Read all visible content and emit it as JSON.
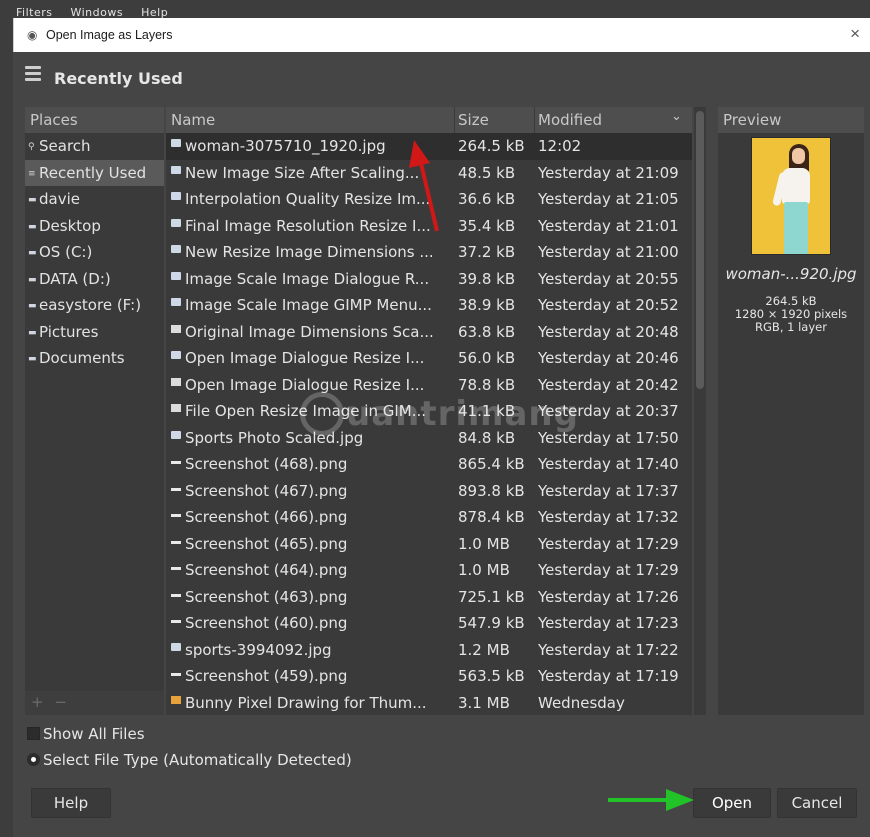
{
  "background_menu": [
    "Filters",
    "Windows",
    "Help"
  ],
  "dialog": {
    "title": "Open Image as Layers",
    "close_label": "×",
    "header_title": "Recently Used"
  },
  "places": {
    "header": "Places",
    "items": [
      {
        "label": "Search",
        "icon": "search-icon"
      },
      {
        "label": "Recently Used",
        "icon": "recent-icon",
        "selected": true
      },
      {
        "label": "davie",
        "icon": "folder-icon"
      },
      {
        "label": "Desktop",
        "icon": "folder-icon"
      },
      {
        "label": "OS (C:)",
        "icon": "drive-icon"
      },
      {
        "label": "DATA (D:)",
        "icon": "drive-icon"
      },
      {
        "label": "easystore (F:)",
        "icon": "drive-icon"
      },
      {
        "label": "Pictures",
        "icon": "folder-icon"
      },
      {
        "label": "Documents",
        "icon": "folder-icon"
      }
    ],
    "footer_add": "+",
    "footer_remove": "−"
  },
  "file_list": {
    "columns": {
      "name": "Name",
      "size": "Size",
      "modified": "Modified"
    },
    "rows": [
      {
        "name": "woman-3075710_1920.jpg",
        "size": "264.5 kB",
        "modified": "12:02",
        "type": "img",
        "selected": true
      },
      {
        "name": "New Image Size After Scaling...",
        "size": "48.5 kB",
        "modified": "Yesterday at 21:09",
        "type": "img"
      },
      {
        "name": "Interpolation Quality Resize Im...",
        "size": "36.6 kB",
        "modified": "Yesterday at 21:05",
        "type": "img"
      },
      {
        "name": "Final Image Resolution Resize I...",
        "size": "35.4 kB",
        "modified": "Yesterday at 21:01",
        "type": "img"
      },
      {
        "name": "New Resize Image Dimensions ...",
        "size": "37.2 kB",
        "modified": "Yesterday at 21:00",
        "type": "img"
      },
      {
        "name": "Image Scale Image Dialogue R...",
        "size": "39.8 kB",
        "modified": "Yesterday at 20:55",
        "type": "img"
      },
      {
        "name": "Image Scale Image GIMP Menu...",
        "size": "38.9 kB",
        "modified": "Yesterday at 20:52",
        "type": "img"
      },
      {
        "name": "Original Image Dimensions Sca...",
        "size": "63.8 kB",
        "modified": "Yesterday at 20:48",
        "type": "jpg2"
      },
      {
        "name": "Open Image Dialogue Resize I...",
        "size": "56.0 kB",
        "modified": "Yesterday at 20:46",
        "type": "img"
      },
      {
        "name": "Open Image Dialogue Resize I...",
        "size": "78.8 kB",
        "modified": "Yesterday at 20:42",
        "type": "jpg2"
      },
      {
        "name": "File Open Resize Image in GIM...",
        "size": "41.1 kB",
        "modified": "Yesterday at 20:37",
        "type": "jpg2"
      },
      {
        "name": "Sports Photo Scaled.jpg",
        "size": "84.8 kB",
        "modified": "Yesterday at 17:50",
        "type": "img"
      },
      {
        "name": "Screenshot (468).png",
        "size": "865.4 kB",
        "modified": "Yesterday at 17:40",
        "type": "png"
      },
      {
        "name": "Screenshot (467).png",
        "size": "893.8 kB",
        "modified": "Yesterday at 17:37",
        "type": "png"
      },
      {
        "name": "Screenshot (466).png",
        "size": "878.4 kB",
        "modified": "Yesterday at 17:32",
        "type": "png"
      },
      {
        "name": "Screenshot (465).png",
        "size": "1.0 MB",
        "modified": "Yesterday at 17:29",
        "type": "png"
      },
      {
        "name": "Screenshot (464).png",
        "size": "1.0 MB",
        "modified": "Yesterday at 17:29",
        "type": "png"
      },
      {
        "name": "Screenshot (463).png",
        "size": "725.1 kB",
        "modified": "Yesterday at 17:26",
        "type": "png"
      },
      {
        "name": "Screenshot (460).png",
        "size": "547.9 kB",
        "modified": "Yesterday at 17:23",
        "type": "png"
      },
      {
        "name": "sports-3994092.jpg",
        "size": "1.2 MB",
        "modified": "Yesterday at 17:22",
        "type": "img"
      },
      {
        "name": "Screenshot (459).png",
        "size": "563.5 kB",
        "modified": "Yesterday at 17:19",
        "type": "png"
      },
      {
        "name": "Bunny Pixel Drawing for Thum...",
        "size": "3.1 MB",
        "modified": "Wednesday",
        "type": "xcf"
      }
    ]
  },
  "preview": {
    "header": "Preview",
    "filename": "woman-...920.jpg",
    "size": "264.5 kB",
    "dimensions": "1280 × 1920 pixels",
    "mode": "RGB, 1 layer"
  },
  "options": {
    "show_all_files": "Show All Files",
    "file_type": "Select File Type (Automatically Detected)"
  },
  "buttons": {
    "help": "Help",
    "open": "Open",
    "cancel": "Cancel"
  },
  "annotation": {
    "watermark": "uantrimang",
    "arrow_colors": {
      "red": "#d01818",
      "green": "#22c229"
    }
  }
}
